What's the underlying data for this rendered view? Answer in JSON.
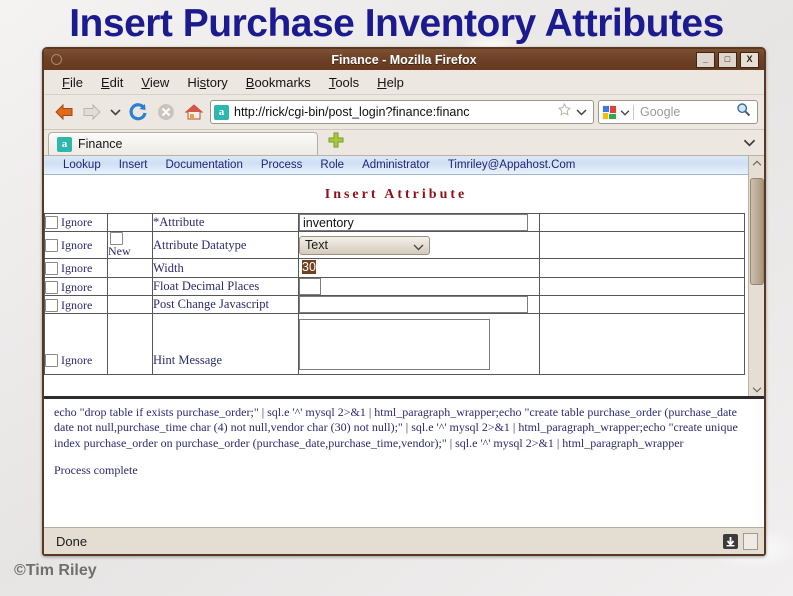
{
  "slide": {
    "title": "Insert Purchase Inventory Attributes",
    "copyright": "©Tim Riley",
    "title_color": "#1b1b8f"
  },
  "window": {
    "title": "Finance - Mozilla Firefox",
    "minimize_label": "_",
    "maximize_label": "□",
    "close_label": "X"
  },
  "menubar": {
    "items": [
      {
        "label": "File",
        "accel": "F"
      },
      {
        "label": "Edit",
        "accel": "E"
      },
      {
        "label": "View",
        "accel": "V"
      },
      {
        "label": "History",
        "accel": "s"
      },
      {
        "label": "Bookmarks",
        "accel": "B"
      },
      {
        "label": "Tools",
        "accel": "T"
      },
      {
        "label": "Help",
        "accel": "H"
      }
    ]
  },
  "toolbar": {
    "back_icon": "back-arrow-icon",
    "forward_icon": "forward-arrow-icon",
    "history_dropdown_icon": "chevron-down-icon",
    "reload_icon": "reload-icon",
    "stop_icon": "stop-icon",
    "home_icon": "home-icon",
    "url": "http://rick/cgi-bin/post_login?finance:financ",
    "url_favicon": "a",
    "bookmark_icon": "star-icon",
    "url_dropdown_icon": "chevron-down-icon",
    "search_engine": "google-logo-icon",
    "search_placeholder": "Google",
    "search_icon": "magnifier-icon"
  },
  "tabstrip": {
    "tabs": [
      {
        "label": "Finance",
        "favicon": "a"
      }
    ],
    "new_tab_icon": "plus-icon",
    "list_all_tabs_icon": "chevron-down-icon"
  },
  "appnav": {
    "links": [
      "Lookup",
      "Insert",
      "Documentation",
      "Process",
      "Role",
      "Administrator",
      "Timriley@Appahost.Com"
    ]
  },
  "form": {
    "heading": "Insert Attribute",
    "ignore_label": "Ignore",
    "new_label": "New",
    "datatype_options": [
      "Text"
    ],
    "rows": [
      {
        "label": "*Attribute",
        "type": "text",
        "value": "inventory",
        "has_new": false
      },
      {
        "label": "Attribute Datatype",
        "type": "select",
        "value": "Text",
        "has_new": true
      },
      {
        "label": "Width",
        "type": "text-focused",
        "value": "30",
        "has_new": false
      },
      {
        "label": "Float Decimal Places",
        "type": "text-tiny",
        "value": "",
        "has_new": false
      },
      {
        "label": "Post Change Javascript",
        "type": "text",
        "value": "",
        "has_new": false
      },
      {
        "label": "Hint Message",
        "type": "textarea",
        "value": "",
        "has_new": false
      }
    ]
  },
  "output": {
    "script": "echo \"drop table if exists purchase_order;\" | sql.e '^' mysql 2>&1 | html_paragraph_wrapper;echo \"create table purchase_order (purchase_date date not null,purchase_time char (4) not null,vendor char (30) not null);\" | sql.e '^' mysql 2>&1 | html_paragraph_wrapper;echo \"create unique index purchase_order on purchase_order (purchase_date,purchase_time,vendor);\" | sql.e '^' mysql 2>&1 | html_paragraph_wrapper",
    "status_message": "Process complete"
  },
  "statusbar": {
    "text": "Done",
    "download_icon": "download-icon",
    "notes_icon": "notepad-icon"
  }
}
